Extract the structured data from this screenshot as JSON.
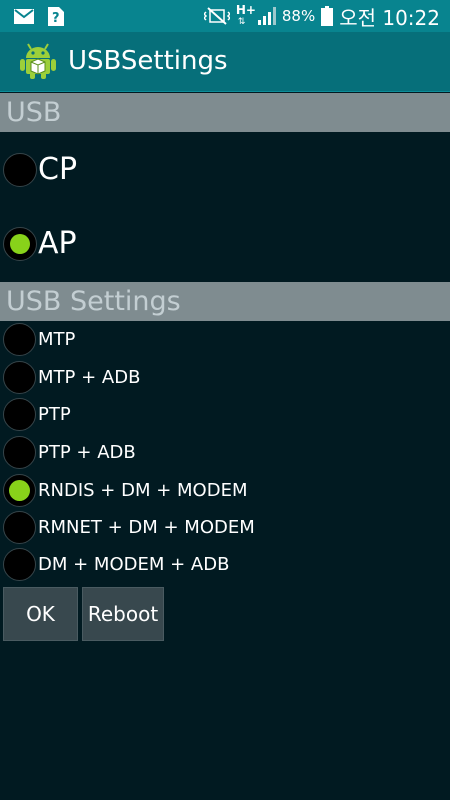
{
  "status_bar": {
    "battery_percent": "88%",
    "time": "오전 10:22",
    "icons": [
      "mail-icon",
      "unknown-file-icon",
      "vibrate-icon",
      "hplus-network-icon",
      "signal-icon",
      "battery-icon"
    ]
  },
  "action_bar": {
    "title": "USBSettings",
    "icon": "android-app-icon"
  },
  "usb_section": {
    "header": "USB",
    "options": [
      {
        "label": "CP",
        "checked": false
      },
      {
        "label": "AP",
        "checked": true
      }
    ]
  },
  "usb_settings_section": {
    "header": "USB Settings",
    "options": [
      {
        "label": "MTP",
        "checked": false
      },
      {
        "label": "MTP + ADB",
        "checked": false
      },
      {
        "label": "PTP",
        "checked": false
      },
      {
        "label": "PTP + ADB",
        "checked": false
      },
      {
        "label": "RNDIS + DM + MODEM",
        "checked": true
      },
      {
        "label": "RMNET + DM + MODEM",
        "checked": false
      },
      {
        "label": "DM + MODEM + ADB",
        "checked": false
      }
    ]
  },
  "buttons": {
    "ok_label": "OK",
    "reboot_label": "Reboot"
  },
  "colors": {
    "status_bar_bg": "#08848f",
    "action_bar_bg": "#066f7a",
    "page_bg": "#011a21",
    "section_header_bg": "#7f8c90",
    "radio_checked": "#88d21a",
    "button_bg": "#38484e"
  }
}
